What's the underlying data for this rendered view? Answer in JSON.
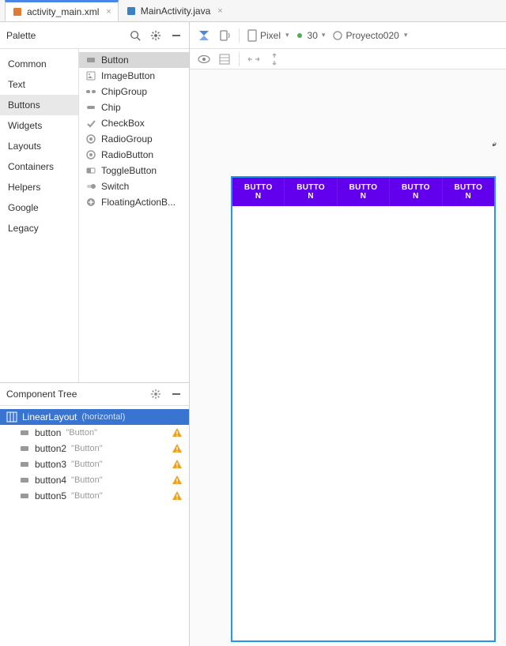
{
  "tabs": [
    {
      "label": "activity_main.xml",
      "active": true,
      "icon_color": "#e07b34"
    },
    {
      "label": "MainActivity.java",
      "active": false,
      "icon_color": "#3b82c4"
    }
  ],
  "palette": {
    "title": "Palette",
    "categories": [
      {
        "label": "Common",
        "selected": false
      },
      {
        "label": "Text",
        "selected": false
      },
      {
        "label": "Buttons",
        "selected": true
      },
      {
        "label": "Widgets",
        "selected": false
      },
      {
        "label": "Layouts",
        "selected": false
      },
      {
        "label": "Containers",
        "selected": false
      },
      {
        "label": "Helpers",
        "selected": false
      },
      {
        "label": "Google",
        "selected": false
      },
      {
        "label": "Legacy",
        "selected": false
      }
    ],
    "widgets": [
      {
        "label": "Button",
        "selected": true,
        "icon": "rect"
      },
      {
        "label": "ImageButton",
        "selected": false,
        "icon": "image"
      },
      {
        "label": "ChipGroup",
        "selected": false,
        "icon": "chipgroup"
      },
      {
        "label": "Chip",
        "selected": false,
        "icon": "chip"
      },
      {
        "label": "CheckBox",
        "selected": false,
        "icon": "check"
      },
      {
        "label": "RadioGroup",
        "selected": false,
        "icon": "radio"
      },
      {
        "label": "RadioButton",
        "selected": false,
        "icon": "radio"
      },
      {
        "label": "ToggleButton",
        "selected": false,
        "icon": "toggle"
      },
      {
        "label": "Switch",
        "selected": false,
        "icon": "switch"
      },
      {
        "label": "FloatingActionB...",
        "selected": false,
        "icon": "fab"
      }
    ]
  },
  "component_tree": {
    "title": "Component Tree",
    "items": [
      {
        "indent": 0,
        "label": "LinearLayout",
        "detail": "(horizontal)",
        "selected": true,
        "icon": "layout",
        "warn": false
      },
      {
        "indent": 1,
        "label": "button",
        "detail": "\"Button\"",
        "selected": false,
        "icon": "rect",
        "warn": true
      },
      {
        "indent": 1,
        "label": "button2",
        "detail": "\"Button\"",
        "selected": false,
        "icon": "rect",
        "warn": true
      },
      {
        "indent": 1,
        "label": "button3",
        "detail": "\"Button\"",
        "selected": false,
        "icon": "rect",
        "warn": true
      },
      {
        "indent": 1,
        "label": "button4",
        "detail": "\"Button\"",
        "selected": false,
        "icon": "rect",
        "warn": true
      },
      {
        "indent": 1,
        "label": "button5",
        "detail": "\"Button\"",
        "selected": false,
        "icon": "rect",
        "warn": true
      }
    ]
  },
  "designer_toolbar": {
    "device": "Pixel",
    "api": "30",
    "theme": "Proyecto020"
  },
  "canvas": {
    "buttons": [
      "BUTTON",
      "BUTTON",
      "BUTTON",
      "BUTTON",
      "BUTTON"
    ]
  }
}
